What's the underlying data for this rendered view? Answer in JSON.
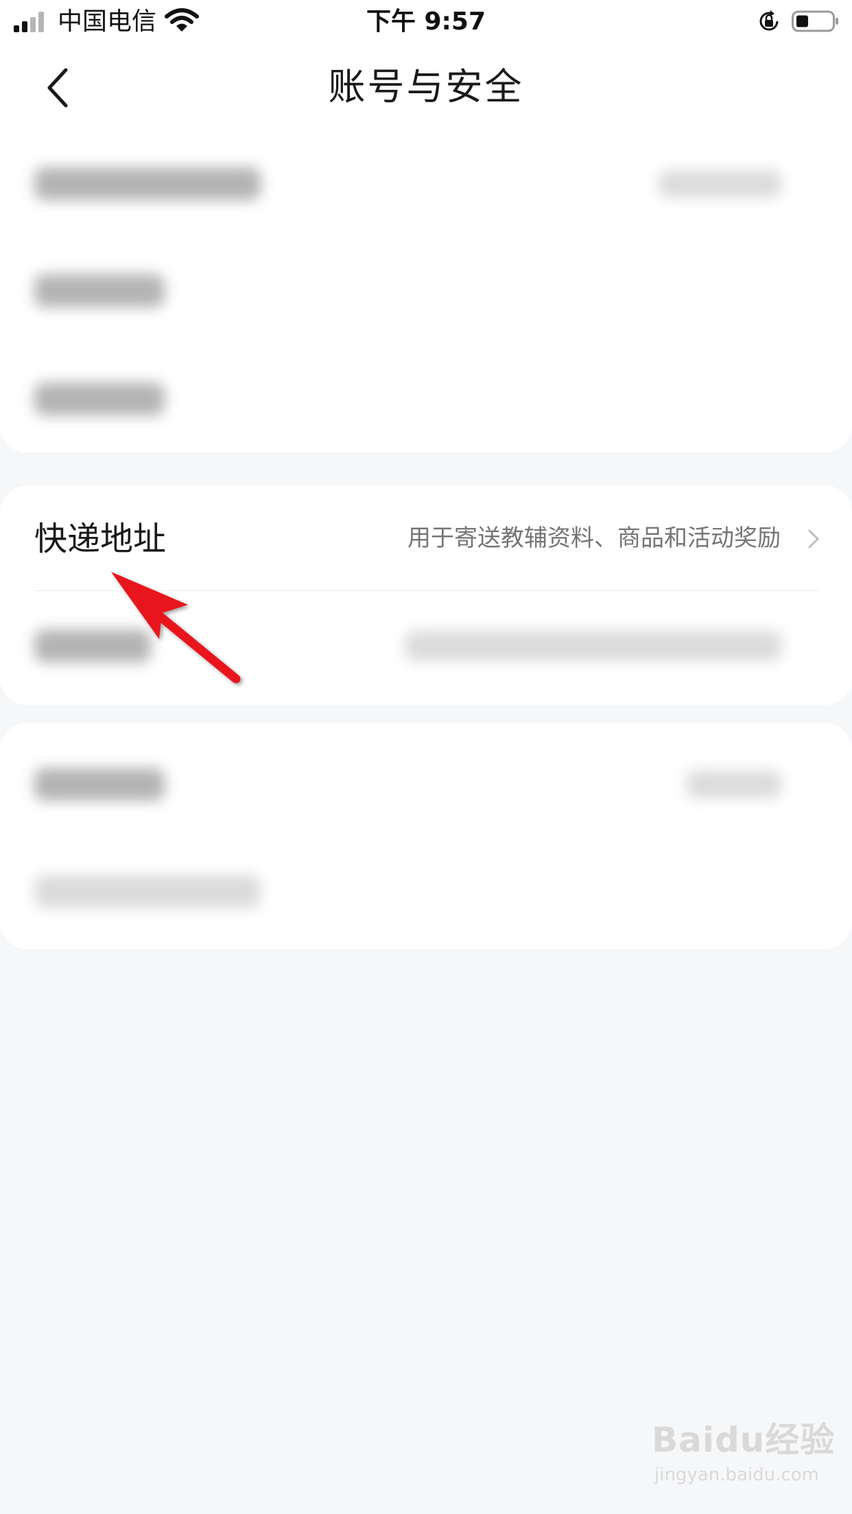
{
  "status_bar": {
    "carrier": "中国电信",
    "time": "下午 9:57",
    "icons": [
      "signal-icon",
      "wifi-icon",
      "orientation-lock-icon",
      "battery-icon"
    ]
  },
  "header": {
    "title": "账号与安全",
    "back_icon": "chevron-left-icon"
  },
  "address_row": {
    "label": "快递地址",
    "description": "用于寄送教辅资料、商品和活动奖励",
    "icon": "chevron-right-icon"
  },
  "annotation": {
    "icon": "red-arrow-icon",
    "color": "#e8131a"
  },
  "watermark": {
    "logo": "Baidu经验",
    "url": "jingyan.baidu.com"
  },
  "colors": {
    "background": "#f6f7f9",
    "card": "#ffffff",
    "description_text": "#757575",
    "title_text": "#1a1a1a"
  }
}
